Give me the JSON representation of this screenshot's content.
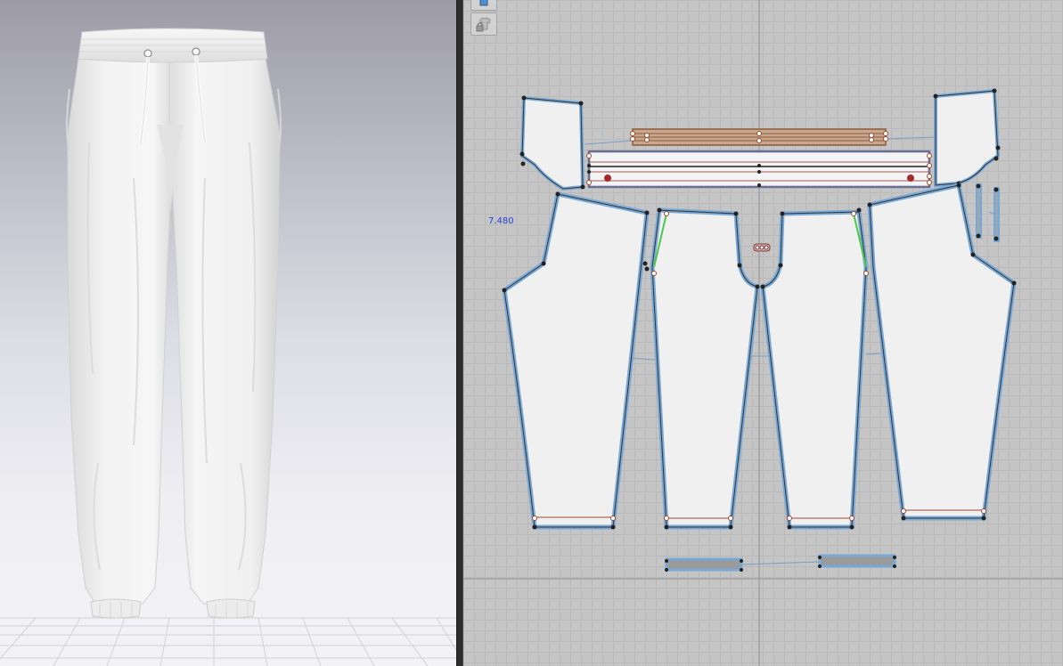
{
  "viewport3d": {
    "garment": "jogger-pants",
    "background_top": "#9d9ca6",
    "background_bottom": "#f3f3f7",
    "fabric_color": "#f1f1f1"
  },
  "viewport2d": {
    "background": "#c5c5c5",
    "piece_outline_color": "#78a8d6",
    "piece_fill": "#f0f0f0",
    "measurement_value": "7.480",
    "measurement_color": "#2b3fd1",
    "toolbar": {
      "show_3d_garment_icon": "tshirt-icon",
      "lock_icon": "lock-icon"
    }
  }
}
